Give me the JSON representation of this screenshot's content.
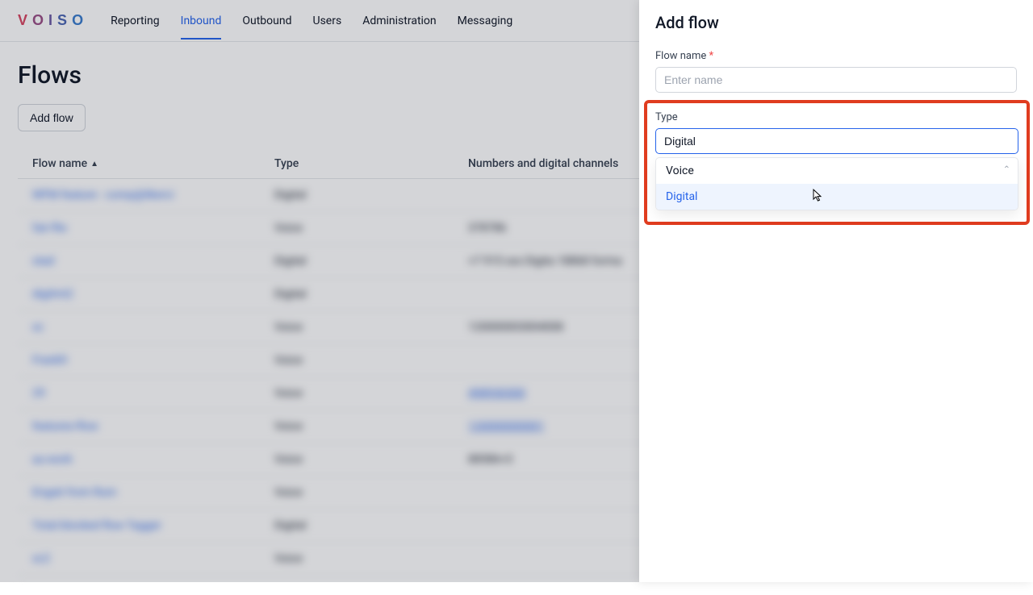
{
  "logo": {
    "c1": "V",
    "c2": "O",
    "c3": "I",
    "c4": "S",
    "c5": "O"
  },
  "nav": {
    "items": [
      {
        "label": "Reporting"
      },
      {
        "label": "Inbound"
      },
      {
        "label": "Outbound"
      },
      {
        "label": "Users"
      },
      {
        "label": "Administration"
      },
      {
        "label": "Messaging"
      }
    ],
    "active_index": 1
  },
  "page": {
    "title": "Flows",
    "add_flow_label": "Add flow"
  },
  "table": {
    "columns": {
      "name": "Flow name",
      "type": "Type",
      "numbers": "Numbers and digital channels"
    },
    "rows": [
      {
        "name": "WFM feature - comp@ilkerci",
        "type": "Digital",
        "numbers": ""
      },
      {
        "name": "fair-flw",
        "type": "Voice",
        "numbers": "378786"
      },
      {
        "name": "stad",
        "type": "Digital",
        "numbers": "+7 915 xxx Digita 18868 forma"
      },
      {
        "name": "digilmt2",
        "type": "Digital",
        "numbers": ""
      },
      {
        "name": "xc",
        "type": "Voice",
        "numbers": "120000003004008"
      },
      {
        "name": "Frankfr",
        "type": "Voice",
        "numbers": ""
      },
      {
        "name": "29",
        "type": "Voice",
        "numbers": "498930300"
      },
      {
        "name": "features-flow",
        "type": "Voice",
        "numbers": "120000000001"
      },
      {
        "name": "au-work",
        "type": "Voice",
        "numbers": "88586+3"
      },
      {
        "name": "Engati from Rum",
        "type": "Voice",
        "numbers": ""
      },
      {
        "name": "Total blocked flow Tagger",
        "type": "Digital",
        "numbers": ""
      },
      {
        "name": "xc2",
        "type": "Voice",
        "numbers": ""
      }
    ]
  },
  "panel": {
    "title": "Add flow",
    "flow_name_label": "Flow name",
    "flow_name_placeholder": "Enter name",
    "type_label": "Type",
    "type_selected": "Digital",
    "type_options": [
      {
        "label": "Voice"
      },
      {
        "label": "Digital"
      }
    ]
  }
}
